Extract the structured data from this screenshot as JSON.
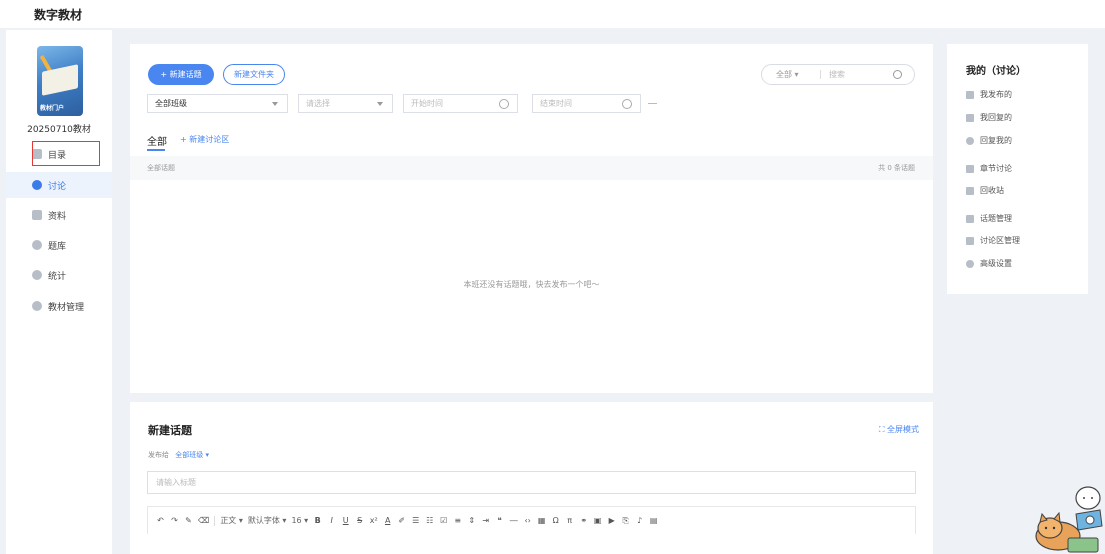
{
  "app": {
    "title": "数字教材"
  },
  "sidebar": {
    "book_name": "20250710教材",
    "cover_tag": "教材门户",
    "items": [
      {
        "label": "目录",
        "icon": "catalog-icon"
      },
      {
        "label": "讨论",
        "icon": "discussion-icon",
        "active": true
      },
      {
        "label": "资料",
        "icon": "folder-icon"
      },
      {
        "label": "题库",
        "icon": "question-bank-icon"
      },
      {
        "label": "统计",
        "icon": "pie-chart-icon"
      },
      {
        "label": "教材管理",
        "icon": "gear-icon"
      }
    ]
  },
  "main": {
    "new_topic_label": "+ 新建话题",
    "new_folder_label": "新建文件夹",
    "search": {
      "scope": "全部",
      "placeholder": "搜索"
    },
    "filters": {
      "class_value": "全部班级",
      "select_placeholder": "请选择",
      "start_placeholder": "开始时间",
      "end_placeholder": "结束时间"
    },
    "tabs": {
      "all_label": "全部",
      "add_area_label": "+ 新建讨论区"
    },
    "list": {
      "header_left": "全部话题",
      "count_text": "共 0 条话题"
    },
    "empty_text": "本班还没有话题哦，快去发布一个吧～"
  },
  "editor": {
    "title": "新建话题",
    "fullscreen_label": "全屏模式",
    "publish_to_label": "发布给",
    "publish_target": "全部班级 ▾",
    "title_placeholder": "请输入标题",
    "toolbar": {
      "paragraph": "正文",
      "font": "默认字体",
      "size": "16"
    }
  },
  "right_panel": {
    "title": "我的（讨论）",
    "items": [
      {
        "label": "我发布的",
        "icon": "publish-icon"
      },
      {
        "label": "我回复的",
        "icon": "reply-icon"
      },
      {
        "label": "回复我的",
        "icon": "chat-icon"
      },
      {
        "label": "章节讨论",
        "icon": "chapter-icon"
      },
      {
        "label": "回收站",
        "icon": "trash-icon"
      },
      {
        "label": "话题管理",
        "icon": "grid-icon"
      },
      {
        "label": "讨论区管理",
        "icon": "tag-icon"
      },
      {
        "label": "高级设置",
        "icon": "settings-icon"
      }
    ]
  },
  "colors": {
    "accent": "#4a86ef",
    "highlight_box": "#e53935",
    "background": "#eef1f5"
  }
}
